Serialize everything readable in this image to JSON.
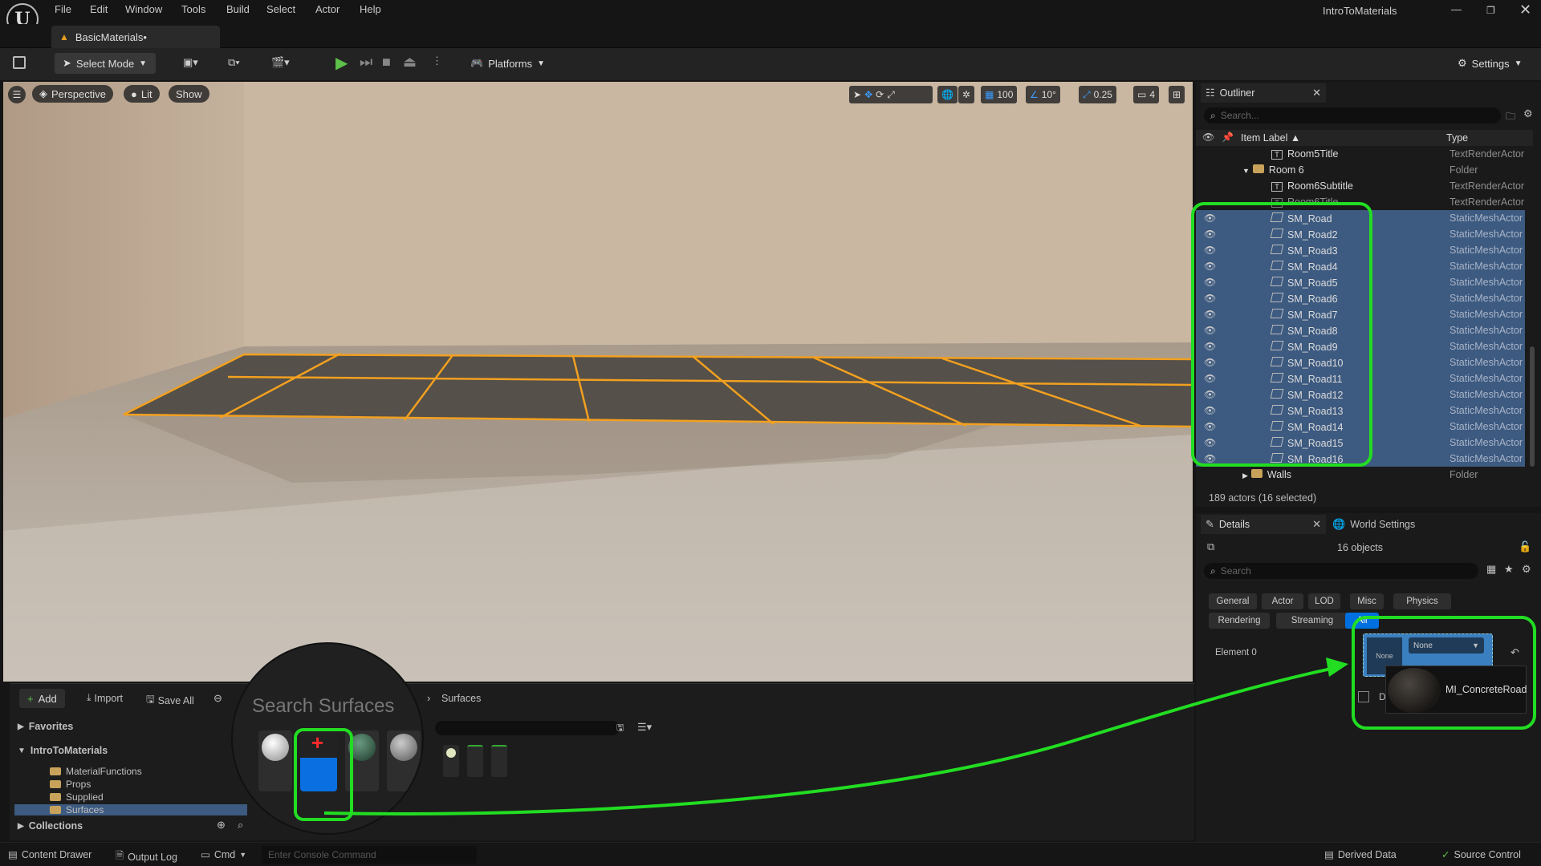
{
  "app": {
    "window_title": "IntroToMaterials",
    "level_tab": "BasicMaterials•"
  },
  "menu": [
    "File",
    "Edit",
    "Window",
    "Tools",
    "Build",
    "Select",
    "Actor",
    "Help"
  ],
  "toolbar": {
    "select_mode": "Select Mode",
    "platforms": "Platforms",
    "settings": "Settings"
  },
  "viewport": {
    "perspective": "Perspective",
    "lit": "Lit",
    "show": "Show",
    "grid_snap": "100",
    "rot_snap": "10°",
    "scale_snap": "0.25",
    "camera_speed": "4"
  },
  "outliner": {
    "tab": "Outliner",
    "search_placeholder": "Search...",
    "col_label": "Item Label ▲",
    "col_type": "Type",
    "rows": [
      {
        "label": "Room5Title",
        "type": "TextRenderActor",
        "kind": "text",
        "indent": 2,
        "selected": false
      },
      {
        "label": "Room 6",
        "type": "Folder",
        "kind": "folder",
        "indent": 1,
        "selected": false,
        "expanded": true
      },
      {
        "label": "Room6Subtitle",
        "type": "TextRenderActor",
        "kind": "text",
        "indent": 2,
        "selected": false
      },
      {
        "label": "Room6Title",
        "type": "TextRenderActor",
        "kind": "text",
        "indent": 2,
        "selected": false
      },
      {
        "label": "SM_Road",
        "type": "StaticMeshActor",
        "kind": "mesh",
        "indent": 2,
        "selected": true
      },
      {
        "label": "SM_Road2",
        "type": "StaticMeshActor",
        "kind": "mesh",
        "indent": 2,
        "selected": true
      },
      {
        "label": "SM_Road3",
        "type": "StaticMeshActor",
        "kind": "mesh",
        "indent": 2,
        "selected": true
      },
      {
        "label": "SM_Road4",
        "type": "StaticMeshActor",
        "kind": "mesh",
        "indent": 2,
        "selected": true
      },
      {
        "label": "SM_Road5",
        "type": "StaticMeshActor",
        "kind": "mesh",
        "indent": 2,
        "selected": true
      },
      {
        "label": "SM_Road6",
        "type": "StaticMeshActor",
        "kind": "mesh",
        "indent": 2,
        "selected": true
      },
      {
        "label": "SM_Road7",
        "type": "StaticMeshActor",
        "kind": "mesh",
        "indent": 2,
        "selected": true
      },
      {
        "label": "SM_Road8",
        "type": "StaticMeshActor",
        "kind": "mesh",
        "indent": 2,
        "selected": true
      },
      {
        "label": "SM_Road9",
        "type": "StaticMeshActor",
        "kind": "mesh",
        "indent": 2,
        "selected": true
      },
      {
        "label": "SM_Road10",
        "type": "StaticMeshActor",
        "kind": "mesh",
        "indent": 2,
        "selected": true
      },
      {
        "label": "SM_Road11",
        "type": "StaticMeshActor",
        "kind": "mesh",
        "indent": 2,
        "selected": true
      },
      {
        "label": "SM_Road12",
        "type": "StaticMeshActor",
        "kind": "mesh",
        "indent": 2,
        "selected": true
      },
      {
        "label": "SM_Road13",
        "type": "StaticMeshActor",
        "kind": "mesh",
        "indent": 2,
        "selected": true
      },
      {
        "label": "SM_Road14",
        "type": "StaticMeshActor",
        "kind": "mesh",
        "indent": 2,
        "selected": true
      },
      {
        "label": "SM_Road15",
        "type": "StaticMeshActor",
        "kind": "mesh",
        "indent": 2,
        "selected": true
      },
      {
        "label": "SM_Road16",
        "type": "StaticMeshActor",
        "kind": "mesh",
        "indent": 2,
        "selected": true
      },
      {
        "label": "Walls",
        "type": "Folder",
        "kind": "folder",
        "indent": 1,
        "selected": false,
        "expanded": false
      }
    ],
    "status": "189 actors (16 selected)"
  },
  "details": {
    "tab": "Details",
    "world_settings": "World Settings",
    "objects": "16 objects",
    "search_placeholder": "Search",
    "filters": [
      "General",
      "Actor",
      "LOD",
      "Misc",
      "Physics",
      "Rendering",
      "Streaming",
      "All"
    ],
    "element_label": "Element 0",
    "none_thumb": "None",
    "none_combo": "None",
    "material_tooltip": "MI_ConcreteRoad",
    "d_label": "D"
  },
  "content": {
    "add": "Add",
    "import": "Import",
    "save_all": "Save All",
    "path": "Surfaces",
    "search_zoom": "Search Surfaces",
    "favorites": "Favorites",
    "root": "IntroToMaterials",
    "folders": [
      "MaterialFunctions",
      "Props",
      "Supplied",
      "Surfaces"
    ],
    "collections": "Collections"
  },
  "statusbar": {
    "content_drawer": "Content Drawer",
    "output_log": "Output Log",
    "cmd": "Cmd",
    "cmd_placeholder": "Enter Console Command",
    "derived": "Derived Data",
    "source": "Source Control"
  },
  "colors": {
    "selection": "#3d5a80",
    "highlight": "#22dd22",
    "accent": "#0070e0",
    "road_outline": "#f2a020"
  }
}
